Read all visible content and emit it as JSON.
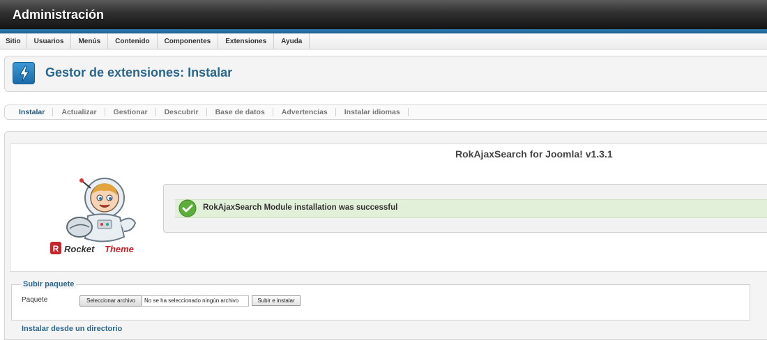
{
  "app": {
    "title": "Administración"
  },
  "menu": {
    "items": [
      "Sitio",
      "Usuarios",
      "Menús",
      "Contenido",
      "Componentes",
      "Extensiones",
      "Ayuda"
    ]
  },
  "header": {
    "title": "Gestor de extensiones: Instalar",
    "icon": "lightning-icon"
  },
  "subnav": {
    "items": [
      "Instalar",
      "Actualizar",
      "Gestionar",
      "Descubrir",
      "Base de datos",
      "Advertencias",
      "Instalar idiomas"
    ],
    "active": "Instalar"
  },
  "install_result": {
    "title": "RokAjaxSearch for Joomla! v1.3.1",
    "message": "RokAjaxSearch Module installation was successful",
    "logo_text": "RocketTheme",
    "status_color": "#5cae3a"
  },
  "upload": {
    "legend": "Subir paquete",
    "label": "Paquete",
    "choose_button": "Seleccionar archivo",
    "file_status": "No se ha seleccionado ningún archivo",
    "submit_button": "Subir e instalar"
  },
  "next_section": {
    "legend": "Instalar desde un directorio"
  }
}
